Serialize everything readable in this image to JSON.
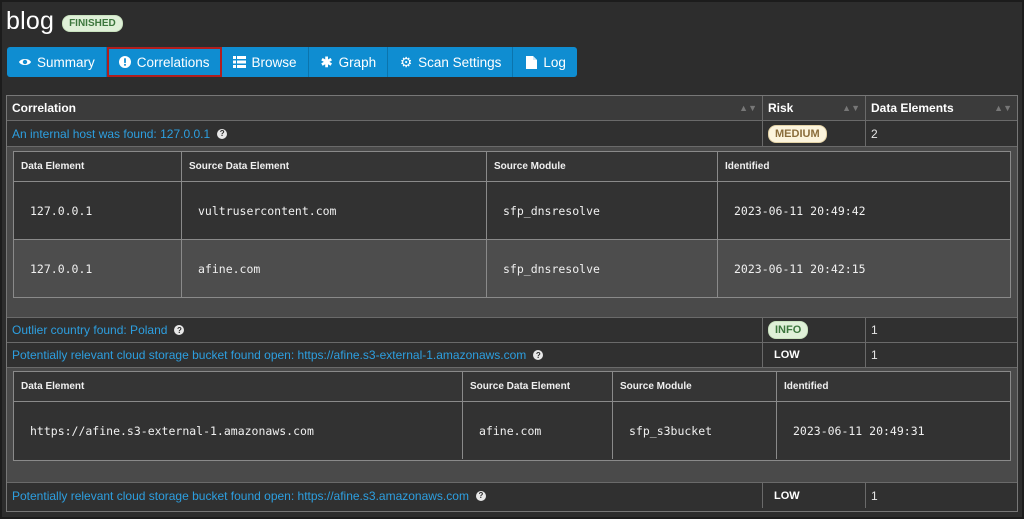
{
  "header": {
    "title": "blog",
    "status": "FINISHED"
  },
  "tabs": [
    {
      "label": "Summary",
      "icon": "eye-icon"
    },
    {
      "label": "Correlations",
      "icon": "exclamation-circle-icon",
      "active": true
    },
    {
      "label": "Browse",
      "icon": "list-icon"
    },
    {
      "label": "Graph",
      "icon": "asterisk-icon"
    },
    {
      "label": "Scan Settings",
      "icon": "gear-icon"
    },
    {
      "label": "Log",
      "icon": "file-icon"
    }
  ],
  "table": {
    "headers": [
      "Correlation",
      "Risk",
      "Data Elements"
    ],
    "rows": [
      {
        "title": "An internal host was found: 127.0.0.1",
        "risk": "MEDIUM",
        "count": "2",
        "details": {
          "headers": [
            "Data Element",
            "Source Data Element",
            "Source Module",
            "Identified"
          ],
          "rows": [
            [
              "127.0.0.1",
              "vultrusercontent.com",
              "sfp_dnsresolve",
              "2023-06-11 20:49:42"
            ],
            [
              "127.0.0.1",
              "afine.com",
              "sfp_dnsresolve",
              "2023-06-11 20:42:15"
            ]
          ]
        }
      },
      {
        "title": "Outlier country found: Poland",
        "risk": "INFO",
        "count": "1"
      },
      {
        "title": "Potentially relevant cloud storage bucket found open: https://afine.s3-external-1.amazonaws.com",
        "risk": "LOW",
        "count": "1",
        "details": {
          "headers": [
            "Data Element",
            "Source Data Element",
            "Source Module",
            "Identified"
          ],
          "rows": [
            [
              "https://afine.s3-external-1.amazonaws.com",
              "afine.com",
              "sfp_s3bucket",
              "2023-06-11 20:49:31"
            ]
          ]
        }
      },
      {
        "title": "Potentially relevant cloud storage bucket found open: https://afine.s3.amazonaws.com",
        "risk": "LOW",
        "count": "1"
      }
    ]
  },
  "colors": {
    "accent": "#0f8dd1",
    "active_outline": "#b01e1e",
    "link": "#2d9fe0"
  }
}
